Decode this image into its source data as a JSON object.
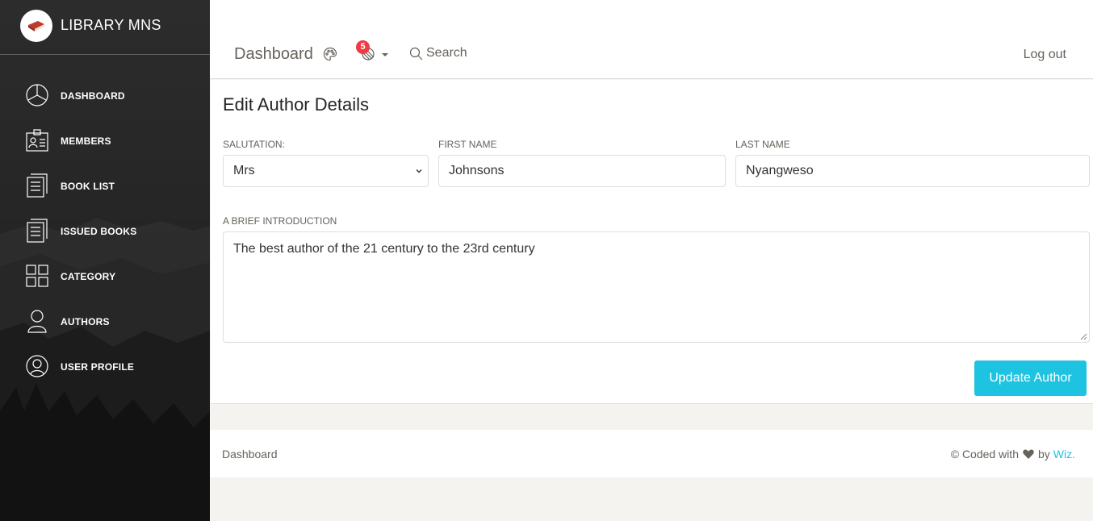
{
  "sidebar": {
    "brand": "LIBRARY MNS",
    "items": [
      {
        "label": "DASHBOARD",
        "icon": "pie-chart-icon"
      },
      {
        "label": "MEMBERS",
        "icon": "id-card-icon"
      },
      {
        "label": "BOOK LIST",
        "icon": "document-icon"
      },
      {
        "label": "ISSUED BOOKS",
        "icon": "document-icon"
      },
      {
        "label": "CATEGORY",
        "icon": "grid-icon"
      },
      {
        "label": "AUTHORS",
        "icon": "user-icon"
      },
      {
        "label": "USER PROFILE",
        "icon": "user-circle-icon"
      }
    ]
  },
  "navbar": {
    "title": "Dashboard",
    "notification_count": "5",
    "search_label": "Search",
    "logout_label": "Log out"
  },
  "form": {
    "title": "Edit Author Details",
    "salutation": {
      "label": "SALUTATION:",
      "value": "Mrs"
    },
    "first_name": {
      "label": "FIRST NAME",
      "value": "Johnsons"
    },
    "last_name": {
      "label": "LAST NAME",
      "value": "Nyangweso"
    },
    "intro": {
      "label": "A BRIEF INTRODUCTION",
      "value": "The best author of the 21 century to the 23rd century"
    },
    "submit_label": "Update Author"
  },
  "footer": {
    "link": "Dashboard",
    "credits_prefix": "© Coded with",
    "credits_by": "by",
    "credits_author": "Wiz."
  },
  "colors": {
    "accent": "#1dc3e0",
    "badge": "#ef3a44",
    "sidebar_bg": "#262626"
  }
}
